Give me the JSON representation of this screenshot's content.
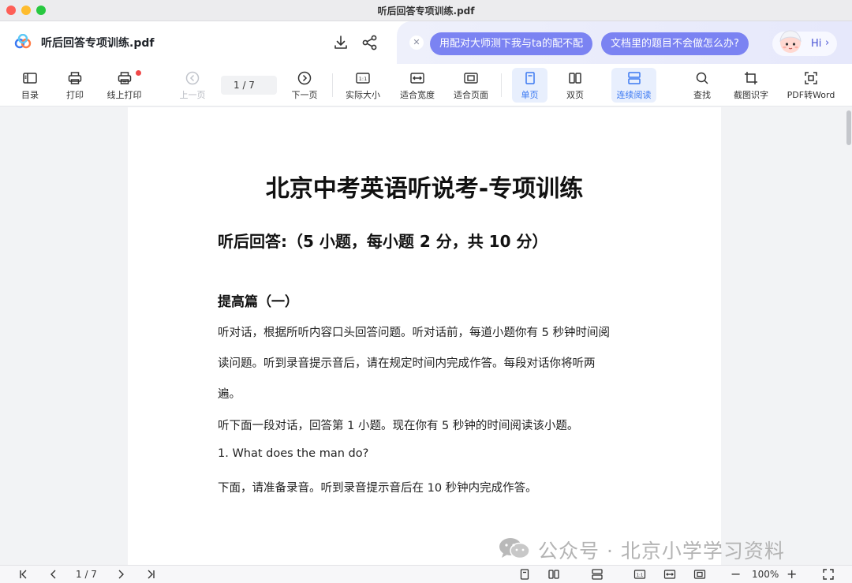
{
  "window": {
    "title": "听后回答专项训练.pdf"
  },
  "header": {
    "doc_name": "听后回答专项训练.pdf",
    "icons": [
      "download-icon",
      "share-icon"
    ]
  },
  "ai_panel": {
    "suggestions": [
      "用配对大师测下我与ta的配不配",
      "文档里的题目不会做怎么办?"
    ],
    "hi_label": "Hi"
  },
  "toolbar": {
    "toc": "目录",
    "print": "打印",
    "online_print": "线上打印",
    "prev_page": "上一页",
    "page_indicator": "1 / 7",
    "next_page": "下一页",
    "actual_size": "实际大小",
    "fit_width": "适合宽度",
    "fit_page": "适合页面",
    "single_page": "单页",
    "double_page": "双页",
    "continuous": "连续阅读",
    "find": "查找",
    "ocr": "截图识字",
    "pdf_to_word": "PDF转Word"
  },
  "document": {
    "title": "北京中考英语听说考-专项训练",
    "subtitle": "听后回答:（5 小题，每小题 2 分，共 10 分）",
    "section": "提高篇（一）",
    "lines": [
      "听对话，根据所听内容口头回答问题。听对话前，每道小题你有 5 秒钟时间阅",
      "读问题。听到录音提示音后，请在规定时间内完成作答。每段对话你将听两",
      "遍。",
      "听下面一段对话，回答第 1 小题。现在你有 5 秒钟的时间阅读该小题。",
      "1.   What does the man do?",
      "下面，请准备录音。听到录音提示音后在 10 秒钟内完成作答。"
    ]
  },
  "watermark": {
    "text": "公众号 · 北京小学学习资料"
  },
  "statusbar": {
    "page_indicator": "1 / 7",
    "zoom": "100%",
    "zoom_out": "−",
    "zoom_in": "+"
  },
  "colors": {
    "accent": "#3a78f2",
    "chip": "#7b83f2",
    "active_bg": "#e8effd",
    "notification": "#f04848"
  }
}
